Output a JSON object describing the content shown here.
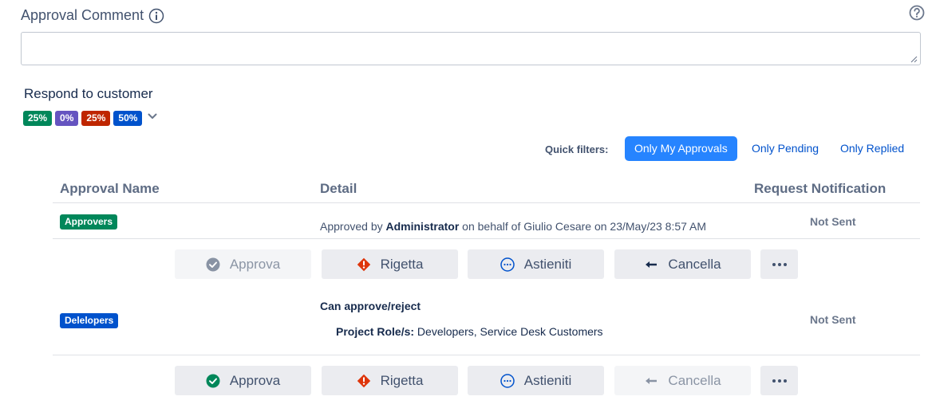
{
  "comment": {
    "label": "Approval Comment",
    "value": "",
    "placeholder": ""
  },
  "respond": {
    "title": "Respond to customer",
    "badges": [
      {
        "text": "25%",
        "color": "#00875a"
      },
      {
        "text": "0%",
        "color": "#6554c0"
      },
      {
        "text": "25%",
        "color": "#bf2600"
      },
      {
        "text": "50%",
        "color": "#0052cc"
      }
    ]
  },
  "quick_filters": {
    "label": "Quick filters:",
    "items": [
      {
        "label": "Only My Approvals",
        "active": true
      },
      {
        "label": "Only Pending",
        "active": false
      },
      {
        "label": "Only Replied",
        "active": false
      }
    ]
  },
  "table": {
    "headers": [
      "Approval Name",
      "Detail",
      "Request Notification"
    ],
    "rows": [
      {
        "group": "Approvers",
        "group_color": "#00875a",
        "detail_prefix": "Approved by ",
        "detail_bold": "Administrator",
        "detail_suffix": " on behalf of Giulio Cesare on 23/May/23 8:57 AM",
        "notification": "Not Sent",
        "actions": {
          "approve": "Approva",
          "reject": "Rigetta",
          "abstain": "Astieniti",
          "cancel": "Cancella"
        }
      },
      {
        "group": "Delelopers",
        "group_color": "#0052cc",
        "detail_title": "Can approve/reject",
        "detail_role_label": "Project Role/s:",
        "detail_role_value": " Developers, Service Desk Customers",
        "notification": "Not Sent",
        "actions": {
          "approve": "Approva",
          "reject": "Rigetta",
          "abstain": "Astieniti",
          "cancel": "Cancella"
        }
      }
    ]
  },
  "colors": {
    "accent": "#2684ff",
    "link": "#0052cc",
    "approve_green": "#00875a",
    "reject_red": "#de350b",
    "abstain_blue": "#0052cc"
  }
}
